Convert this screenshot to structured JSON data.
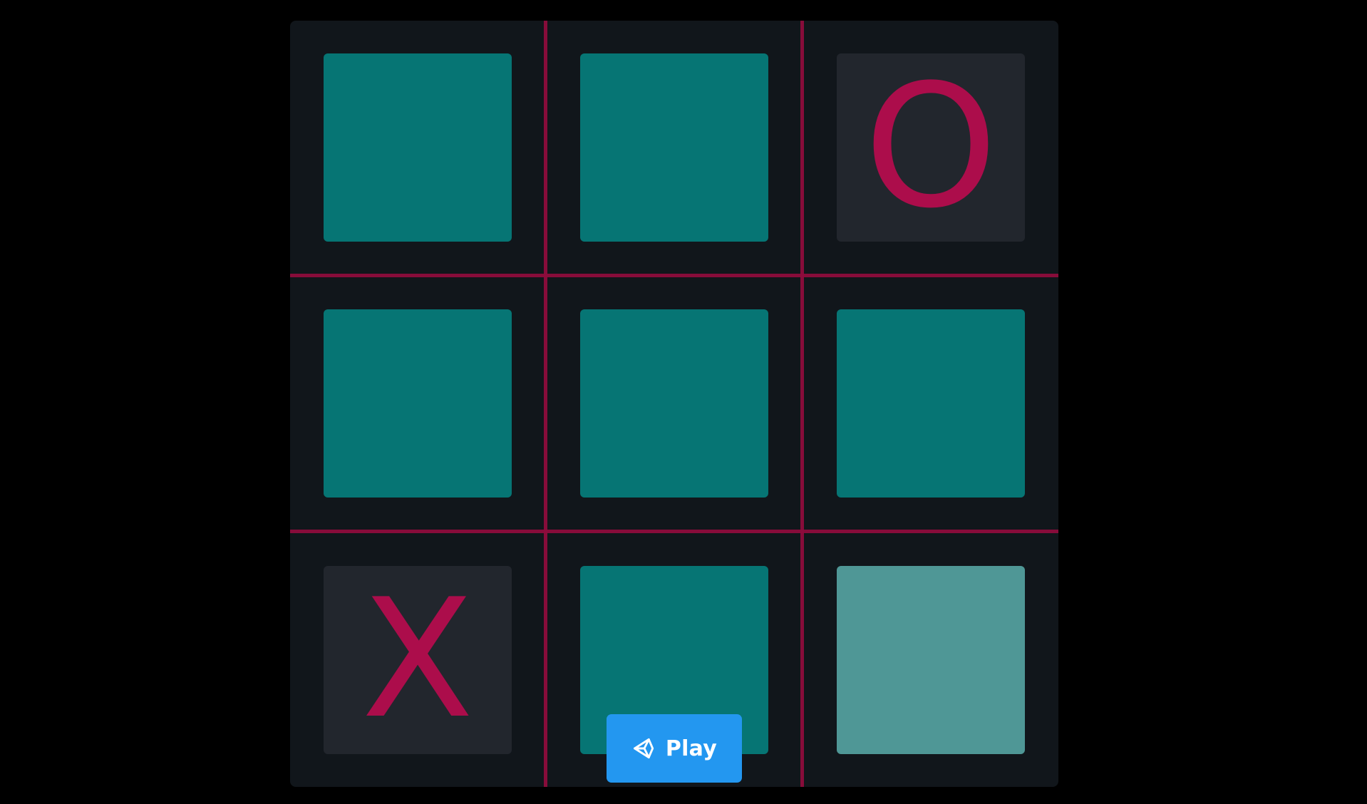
{
  "game": {
    "title": "",
    "board": {
      "rows": 3,
      "cols": 3,
      "cells": [
        {
          "row": 0,
          "col": 0,
          "mark": "",
          "state": "empty"
        },
        {
          "row": 0,
          "col": 1,
          "mark": "",
          "state": "empty"
        },
        {
          "row": 0,
          "col": 2,
          "mark": "O",
          "state": "filled"
        },
        {
          "row": 1,
          "col": 0,
          "mark": "",
          "state": "empty"
        },
        {
          "row": 1,
          "col": 1,
          "mark": "",
          "state": "empty"
        },
        {
          "row": 1,
          "col": 2,
          "mark": "",
          "state": "empty"
        },
        {
          "row": 2,
          "col": 0,
          "mark": "X",
          "state": "filled"
        },
        {
          "row": 2,
          "col": 1,
          "mark": "",
          "state": "empty"
        },
        {
          "row": 2,
          "col": 2,
          "mark": "",
          "state": "hover"
        }
      ]
    }
  },
  "play_button": {
    "label": "Play",
    "icon": "unity-icon"
  },
  "colors": {
    "background": "#000000",
    "board": "#11161b",
    "grid_lines": "#8e0c3c",
    "cell_empty": "#067574",
    "cell_hover": "#4f9796",
    "cell_filled": "#22262d",
    "mark": "#ac0d4b",
    "play_button": "#2397f0",
    "play_button_text": "#ffffff"
  }
}
